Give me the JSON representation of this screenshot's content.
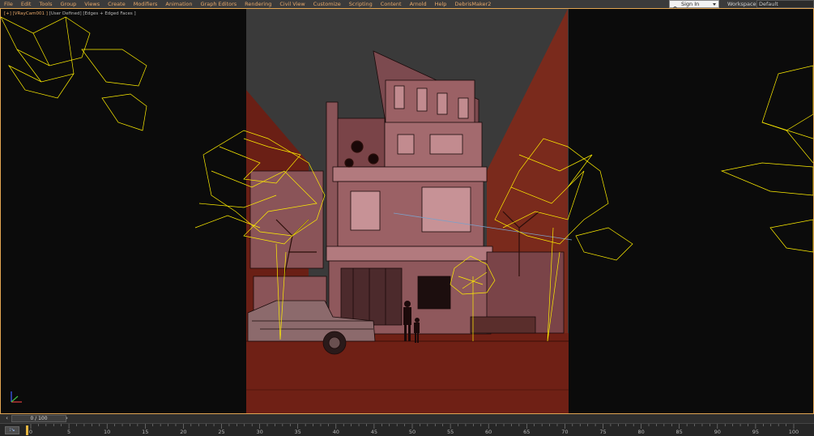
{
  "menu": {
    "items": [
      "File",
      "Edit",
      "Tools",
      "Group",
      "Views",
      "Create",
      "Modifiers",
      "Animation",
      "Graph Editors",
      "Rendering",
      "Civil View",
      "Customize",
      "Scripting",
      "Content",
      "Arnold",
      "Help",
      "DebrisMaker2"
    ]
  },
  "account": {
    "sign_in_label": "Sign In"
  },
  "workspaces": {
    "label": "Workspaces:",
    "value": "Default"
  },
  "viewport": {
    "camera_label": "[+] [VRayCam001 ]",
    "shading_label": " [User Defined] [Edges + Edged Faces ]"
  },
  "timeline": {
    "prev_icon": "chevron-left-icon",
    "next_icon": "chevron-right-icon",
    "frame_label": "0 / 100",
    "ticks": [
      "0",
      "5",
      "10",
      "15",
      "20",
      "25",
      "30",
      "35",
      "40",
      "45",
      "50",
      "55",
      "60",
      "65",
      "70",
      "75",
      "80",
      "85",
      "90",
      "95",
      "100"
    ]
  },
  "colors": {
    "menu_text": "#e7a86a",
    "viewport_border": "#e2a552",
    "wireframe_yellow": "#ffee00",
    "ground_red": "#6f2015",
    "facade_pink": "#9b6165"
  }
}
